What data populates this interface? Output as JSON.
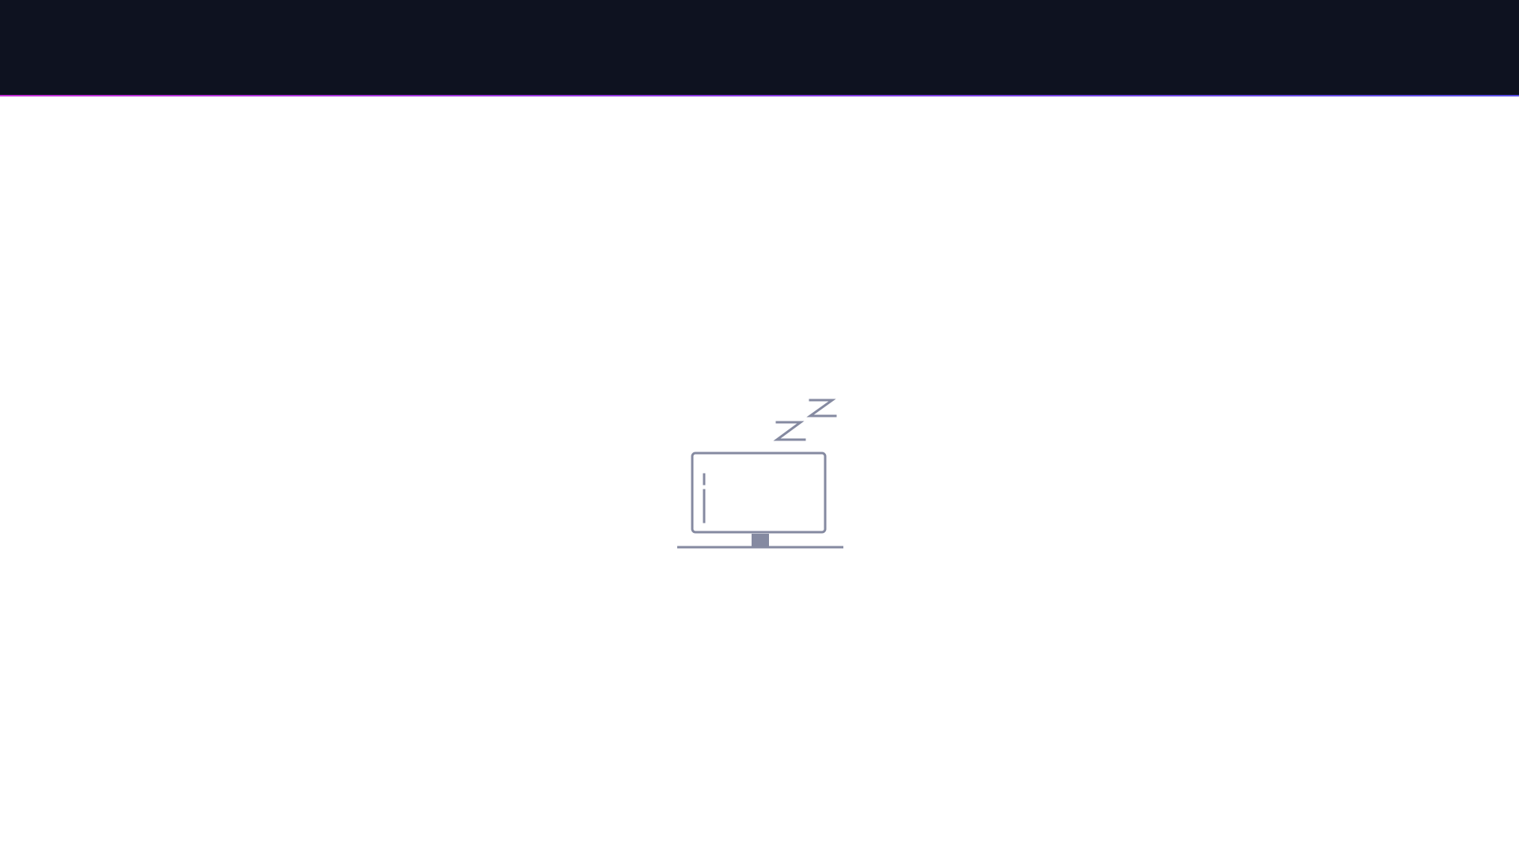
{
  "app": {
    "top_bar": {
      "background": "#0e1220",
      "accent_gradient": [
        "#c531d6",
        "#8d3ae0",
        "#5a4fe3"
      ]
    },
    "main": {
      "state": "idle",
      "illustration": {
        "name": "sleeping-monitor",
        "icon_color": "#858aa1",
        "decorations": [
          "zz-icon"
        ]
      }
    }
  }
}
